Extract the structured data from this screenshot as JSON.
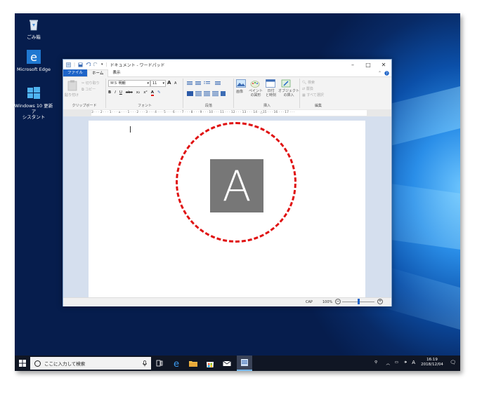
{
  "desktop": {
    "icons": [
      {
        "label": "ごみ箱",
        "icon": "recycle-bin-icon"
      },
      {
        "label": "Microsoft Edge",
        "icon": "edge-icon"
      },
      {
        "label_line1": "Windows 10 更新ア",
        "label_line2": "シスタント",
        "icon": "windows-logo-icon"
      }
    ]
  },
  "window": {
    "title": "ドキュメント - ワードパッド",
    "controls": {
      "minimize": "–",
      "maximize": "□",
      "close": "✕"
    },
    "tabs": [
      {
        "label": "ファイル"
      },
      {
        "label": "ホーム"
      },
      {
        "label": "表示"
      }
    ],
    "ribbon": {
      "clipboard": {
        "paste": "貼り付け",
        "cut": "切り取り",
        "copy": "コピー",
        "label": "クリップボード"
      },
      "font": {
        "name": "ＭＳ 明朝",
        "size": "11",
        "bold": "B",
        "italic": "I",
        "underline": "U",
        "strike": "abc",
        "sub": "x₂",
        "sup": "x²",
        "grow": "A",
        "shrink": "A",
        "label": "フォント"
      },
      "paragraph": {
        "label": "段落"
      },
      "insert": {
        "picture": "画像",
        "paint1": "ペイント",
        "paint2": "の図形",
        "date1": "日付",
        "date2": "と時刻",
        "object1": "オブジェクト",
        "object2": "の挿入",
        "label": "挿入"
      },
      "edit": {
        "find": "検索",
        "replace": "置換",
        "select_all": "すべて選択",
        "label": "編集"
      }
    },
    "ruler_text": "3 · · · 2 · · · 1 · · · ⌂ · · · 1 · · · 2 · · · 3 · · · 4 · · · 5 · · · 6 · · · 7 · · · 8 · · · 9 · · · 10 · · · 11 · · · 12 · · · 13 · · · 14 · △15 · · · 16 · · · 17 · · ·",
    "document": {
      "image_letter": "A"
    },
    "status": {
      "caps": "CAP",
      "zoom": "100%",
      "zoom_minus": "−",
      "zoom_plus": "+",
      "zoom_level": 0.5
    }
  },
  "taskbar": {
    "search_placeholder": "ここに入力して検索",
    "time": "16:19",
    "date": "2018/12/04",
    "ime": "A"
  },
  "colors": {
    "accent": "#1e64c8",
    "highlight_circle": "#e01010",
    "taskbar": "#101624"
  }
}
